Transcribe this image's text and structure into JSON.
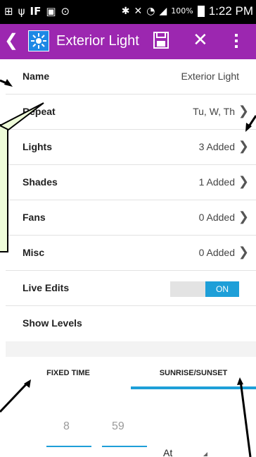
{
  "status_bar": {
    "left_icons": [
      "signal-booster-icon",
      "usb-icon",
      "ifttt-icon",
      "image-icon",
      "clock-icon"
    ],
    "right_icons": [
      "bluetooth-icon",
      "mute-icon",
      "wifi-icon",
      "cell-signal-icon"
    ],
    "battery": "100%",
    "time": "1:22 PM"
  },
  "app_bar": {
    "color": "#9C27B0",
    "back_icon": "back-chevron-icon",
    "logo_icon": "sunburst-icon",
    "title": "Exterior Light",
    "actions": [
      "save-icon",
      "close-icon",
      "more-vert-icon"
    ]
  },
  "settings": {
    "rows": [
      {
        "label": "Name",
        "value": "Exterior Light"
      },
      {
        "label": "Repeat",
        "value": "Tu, W, Th"
      },
      {
        "label": "Lights",
        "value": "3 Added"
      },
      {
        "label": "Shades",
        "value": "1 Added"
      },
      {
        "label": "Fans",
        "value": "0 Added"
      },
      {
        "label": "Misc",
        "value": "0 Added"
      },
      {
        "label": "Live Edits",
        "value": "ON"
      },
      {
        "label": "Show Levels",
        "value": ""
      }
    ]
  },
  "tabs": [
    {
      "label": "FIXED TIME",
      "selected": false
    },
    {
      "label": "SUNRISE/SUNSET",
      "selected": true
    }
  ],
  "time_picker": {
    "hour": "8",
    "minute": "59",
    "mode": "At"
  },
  "colors": {
    "accent": "#1E9FD8",
    "callout_fill": "#eefcd9"
  }
}
